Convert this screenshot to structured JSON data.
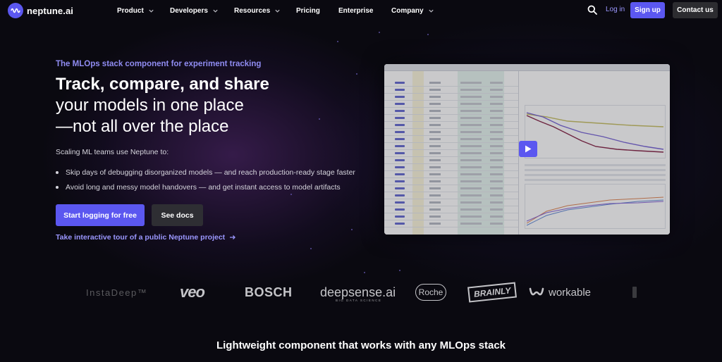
{
  "nav": {
    "logo_text": "neptune.ai",
    "menu": [
      {
        "label": "Product",
        "has_dropdown": true
      },
      {
        "label": "Developers",
        "has_dropdown": true
      },
      {
        "label": "Resources",
        "has_dropdown": true
      },
      {
        "label": "Pricing",
        "has_dropdown": false
      },
      {
        "label": "Enterprise",
        "has_dropdown": false
      },
      {
        "label": "Company",
        "has_dropdown": true
      }
    ],
    "login_label": "Log in",
    "signup_label": "Sign up",
    "contact_label": "Contact us"
  },
  "hero": {
    "eyebrow": "The MLOps stack component for experiment tracking",
    "title_strong": "Track, compare, and share",
    "title_line2": "your models in one place",
    "title_line3": "—not all over the place",
    "lead": "Scaling ML teams use Neptune to:",
    "bullets": [
      "Skip days of debugging disorganized models — and reach production-ready stage faster",
      "Avoid long and messy model handovers — and get instant access to model artifacts"
    ],
    "cta_primary": "Start logging for free",
    "cta_secondary": "See docs",
    "tour_link": "Take interactive tour of a public Neptune project"
  },
  "logos": {
    "instadeep": "InstaDeep™",
    "veo": "veo",
    "bosch": "BOSCH",
    "deepsense": "deepsense.ai",
    "deepsense_sub": "BIG DATA SCIENCE",
    "roche": "Roche",
    "brainly": "BRAINLY",
    "workable": "workable"
  },
  "section_title": "Lightweight component that works with any MLOps stack",
  "colors": {
    "accent": "#5b57f0",
    "link": "#9b97ff",
    "eyebrow": "#908cf2",
    "background": "#0a0910"
  },
  "icons": {
    "logo": "neptune-wave-icon",
    "search": "search-icon",
    "dropdown": "chevron-down-icon",
    "arrow": "arrow-right-icon",
    "play": "play-icon"
  }
}
